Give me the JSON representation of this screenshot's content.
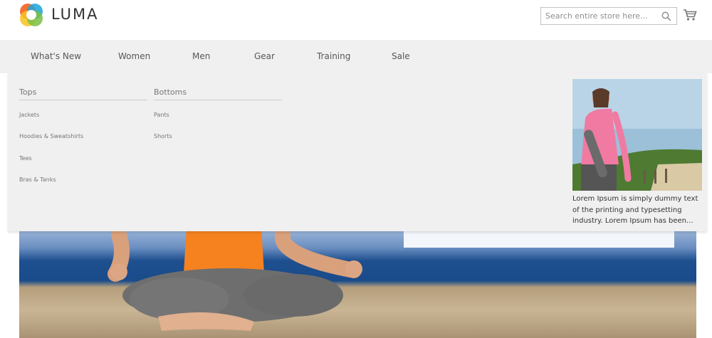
{
  "header": {
    "brand": "LUMA",
    "search": {
      "placeholder": "Search entire store here..."
    }
  },
  "nav": {
    "items": [
      {
        "label": "What's New"
      },
      {
        "label": "Women"
      },
      {
        "label": "Men"
      },
      {
        "label": "Gear"
      },
      {
        "label": "Training"
      },
      {
        "label": "Sale"
      }
    ]
  },
  "mega_menu": {
    "columns": [
      {
        "title": "Tops",
        "links": [
          "Jackets",
          "Hoodies & Sweatshirts",
          "Tees",
          "Bras & Tanks"
        ]
      },
      {
        "title": "Bottoms",
        "links": [
          "Pants",
          "Shorts"
        ]
      }
    ],
    "promo": {
      "text": "Lorem Ipsum is simply dummy text of the printing and typesetting industry. Lorem Ipsum has been..."
    }
  },
  "colors": {
    "nav_background": "#f0f0f0",
    "text": "#333333"
  }
}
